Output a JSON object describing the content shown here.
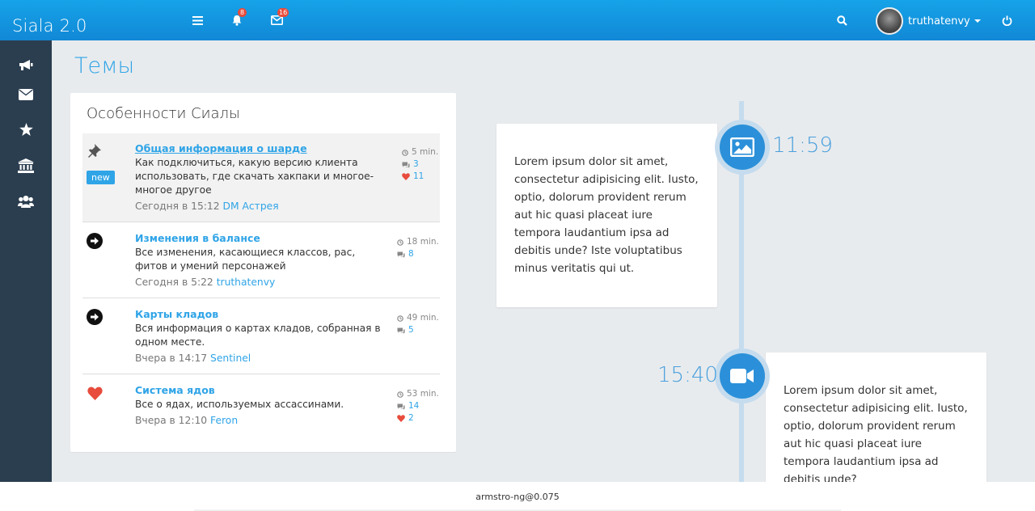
{
  "app": {
    "brand": "Siala 2.0",
    "accent_color": "#2fa4e7",
    "sidebar_color": "#2b3e50"
  },
  "header": {
    "menu_icon": "hamburger-icon",
    "notifications": {
      "icon": "bell-icon",
      "count": "8"
    },
    "messages": {
      "icon": "envelope-icon",
      "count": "16"
    },
    "search_icon": "search-icon",
    "user": {
      "name": "truthatenvy"
    },
    "power_icon": "power-icon"
  },
  "sidebar": {
    "items": [
      {
        "icon": "bullhorn-icon"
      },
      {
        "icon": "envelope-icon"
      },
      {
        "icon": "star-icon"
      },
      {
        "icon": "bank-icon"
      },
      {
        "icon": "users-icon"
      }
    ]
  },
  "page": {
    "title": "Темы"
  },
  "panel": {
    "title": "Особенности Сиалы",
    "topics": [
      {
        "icon": "pin-icon",
        "badge": "new",
        "title": "Общая информация о шарде",
        "description": "Как подключиться, какую версию клиента использовать, где скачать хакпаки и многое-многое другое",
        "when": "Сегодня в 15:12",
        "author": "DM Астрея",
        "time_ago": "5 min.",
        "comments": "3",
        "likes": "11"
      },
      {
        "icon": "arrow-circle-right-icon",
        "title": "Изменения в балансе",
        "description": "Все изменения, касающиеся классов, рас, фитов и умений персонажей",
        "when": "Сегодня в 5:22",
        "author": "truthatenvy",
        "time_ago": "18 min.",
        "comments": "8"
      },
      {
        "icon": "arrow-circle-right-icon",
        "title": "Карты кладов",
        "description": "Вся информация о картах кладов, собранная в одном месте.",
        "when": "Вчера в 14:17",
        "author": "Sentinel",
        "time_ago": "49 min.",
        "comments": "5"
      },
      {
        "icon": "heart-icon",
        "title": "Система ядов",
        "description": "Все о ядах, используемых ассассинами.",
        "when": "Вчера в 12:10",
        "author": "Feron",
        "time_ago": "53 min.",
        "comments": "14",
        "likes": "2"
      }
    ]
  },
  "timeline": {
    "entries": [
      {
        "icon": "picture-icon",
        "time": "11:59",
        "text": "Lorem ipsum dolor sit amet, consectetur adipisicing elit. Iusto, optio, dolorum provident rerum aut hic quasi placeat iure tempora laudantium ipsa ad debitis unde? Iste voluptatibus minus veritatis qui ut."
      },
      {
        "icon": "video-camera-icon",
        "time": "15:40",
        "text": "Lorem ipsum dolor sit amet, consectetur adipisicing elit. Iusto, optio, dolorum provident rerum aut hic quasi placeat iure tempora laudantium ipsa ad debitis unde?"
      }
    ]
  },
  "footer": {
    "text": "armstro-ng@0.075"
  }
}
